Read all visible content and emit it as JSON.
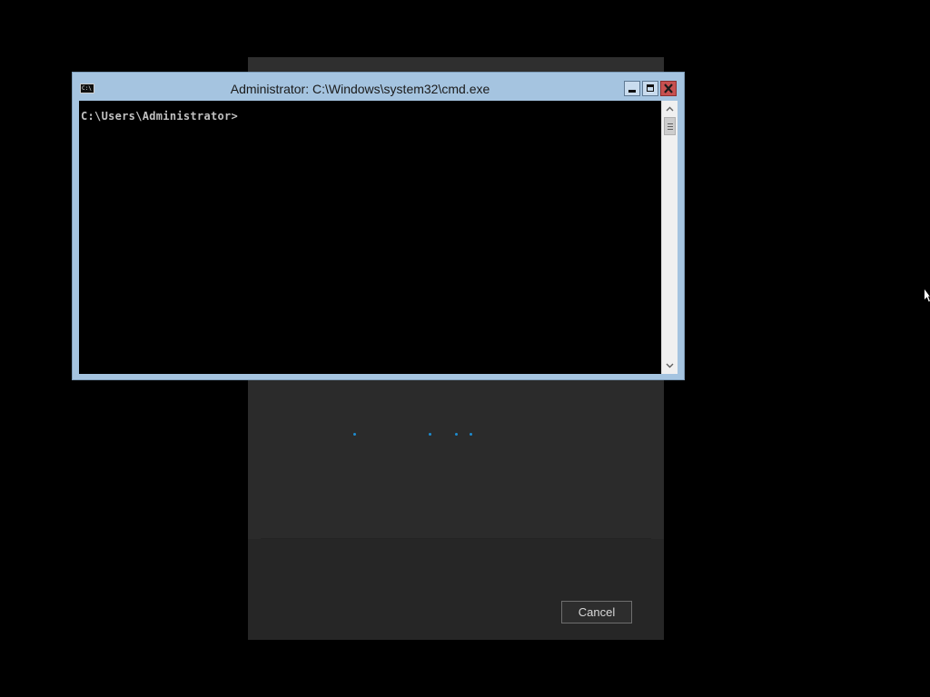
{
  "background_dialog": {
    "cancel_label": "Cancel"
  },
  "cmd_window": {
    "title": "Administrator: C:\\Windows\\system32\\cmd.exe",
    "icon_text": "C:\\",
    "prompt": "C:\\Users\\Administrator>",
    "buttons": [
      "minimize",
      "maximize",
      "close"
    ]
  },
  "colors": {
    "desktop": "#000000",
    "dialog": "#2b2b2b",
    "title_bar": "#a5c4e0",
    "close_button": "#c75050",
    "progress_dots": "#1e8ccf",
    "console_text": "#c0c0c0"
  },
  "icons": {
    "app": "cmd-icon",
    "minimize": "minimize-icon",
    "maximize": "maximize-icon",
    "close": "close-icon",
    "scroll_up": "chevron-up-icon",
    "scroll_down": "chevron-down-icon",
    "cursor": "mouse-cursor-icon"
  }
}
